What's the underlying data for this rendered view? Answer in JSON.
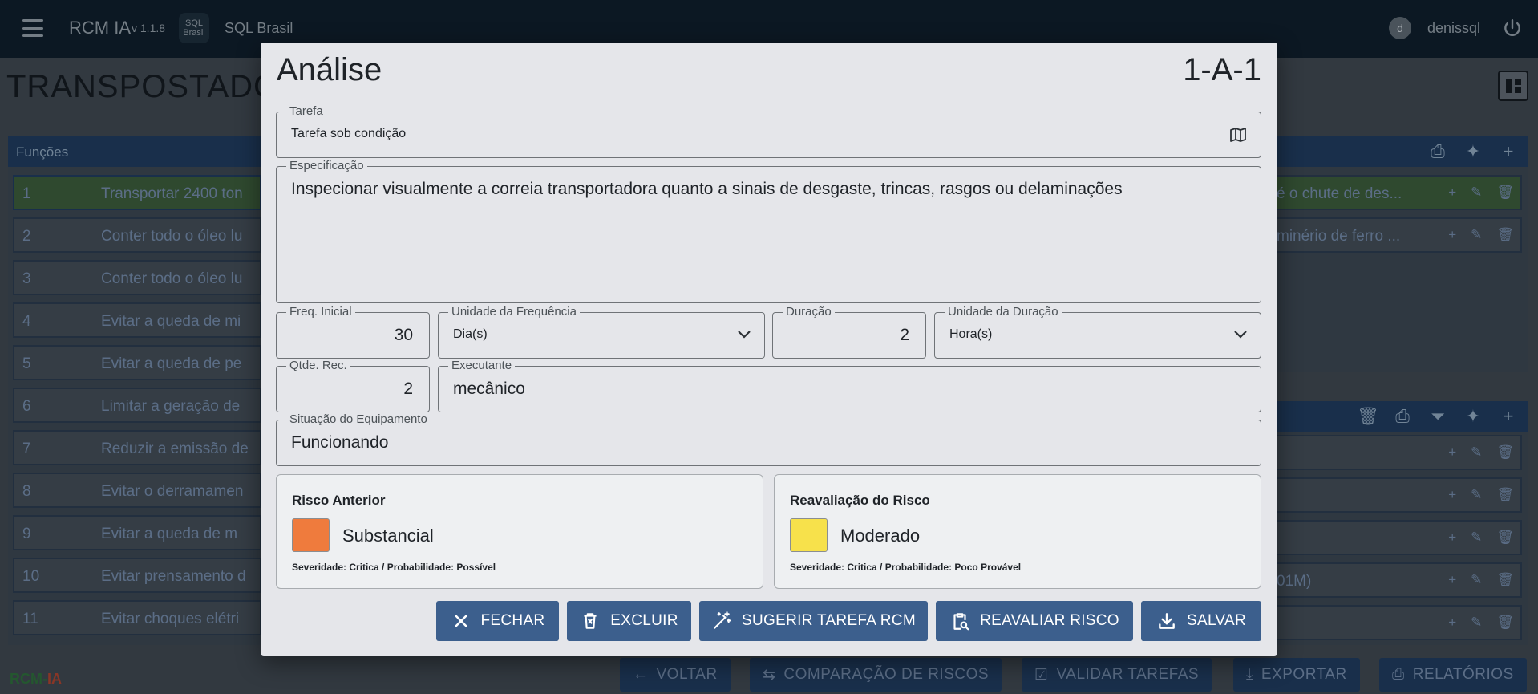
{
  "app": {
    "title": "RCM IA",
    "version": "v 1.1.8",
    "logo_text": "SQL Brasil",
    "org": "SQL Brasil",
    "user_initial": "d",
    "user_name": "denissql"
  },
  "page": {
    "heading": "TRANSPOSTADOR"
  },
  "functions_panel": {
    "title": "Funções",
    "rows": [
      {
        "num": "1",
        "text": "Transportar 2400 ton"
      },
      {
        "num": "2",
        "text": "Conter todo o óleo lu"
      },
      {
        "num": "3",
        "text": "Conter todo o óleo lu"
      },
      {
        "num": "4",
        "text": "Evitar a queda de mi"
      },
      {
        "num": "5",
        "text": "Evitar a queda de pe"
      },
      {
        "num": "6",
        "text": "Limitar a geração de"
      },
      {
        "num": "7",
        "text": "Reduzir a emissão de"
      },
      {
        "num": "8",
        "text": "Evitar o derramamen"
      },
      {
        "num": "9",
        "text": "Evitar a queda de m"
      },
      {
        "num": "10",
        "text": "Evitar prensamento d"
      },
      {
        "num": "11",
        "text": "Evitar choques elétri"
      }
    ]
  },
  "right_panel_top": {
    "rows": [
      {
        "text": "é o chute de des..."
      },
      {
        "text": "minério de ferro ..."
      }
    ]
  },
  "right_panel_bottom": {
    "rows": [
      {
        "text": ""
      },
      {
        "text": ""
      },
      {
        "text": ""
      },
      {
        "text": "01M)"
      },
      {
        "text": ""
      }
    ]
  },
  "bottom_bar": {
    "logo_rcm": "RCM",
    "logo_ia": "IA",
    "buttons": [
      {
        "label": "VOLTAR"
      },
      {
        "label": "COMPARAÇÃO DE RISCOS"
      },
      {
        "label": "VALIDAR TAREFAS"
      },
      {
        "label": "EXPORTAR"
      },
      {
        "label": "RELATÓRIOS"
      }
    ]
  },
  "modal": {
    "title": "Análise",
    "code": "1-A-1",
    "tarefa": {
      "label": "Tarefa",
      "value": "Tarefa sob condição"
    },
    "especificacao": {
      "label": "Especificação",
      "value": "Inspecionar visualmente a correia transportadora quanto a sinais de desgaste, trincas, rasgos ou delaminações"
    },
    "freq_inicial": {
      "label": "Freq. Inicial",
      "value": "30"
    },
    "unidade_frequencia": {
      "label": "Unidade da Frequência",
      "value": "Dia(s)"
    },
    "duracao": {
      "label": "Duração",
      "value": "2"
    },
    "unidade_duracao": {
      "label": "Unidade da Duração",
      "value": "Hora(s)"
    },
    "qtde_rec": {
      "label": "Qtde. Rec.",
      "value": "2"
    },
    "executante": {
      "label": "Executante",
      "value": "mecânico"
    },
    "situacao": {
      "label": "Situação do Equipamento",
      "value": "Funcionando"
    },
    "risco_anterior": {
      "title": "Risco Anterior",
      "level": "Substancial",
      "color": "#ef7b3d",
      "detail": "Severidade: Critica / Probabilidade: Possível"
    },
    "reavaliacao": {
      "title": "Reavaliação do Risco",
      "level": "Moderado",
      "color": "#f7e14b",
      "detail": "Severidade: Critica / Probabilidade: Poco Provável"
    },
    "buttons": {
      "fechar": "FECHAR",
      "excluir": "EXCLUIR",
      "sugerir": "SUGERIR TAREFA RCM",
      "reavaliar": "REAVALIAR RISCO",
      "salvar": "SALVAR"
    }
  },
  "colors": {
    "primary_button": "#3c5f8d",
    "topbar": "#0f1e2b"
  }
}
